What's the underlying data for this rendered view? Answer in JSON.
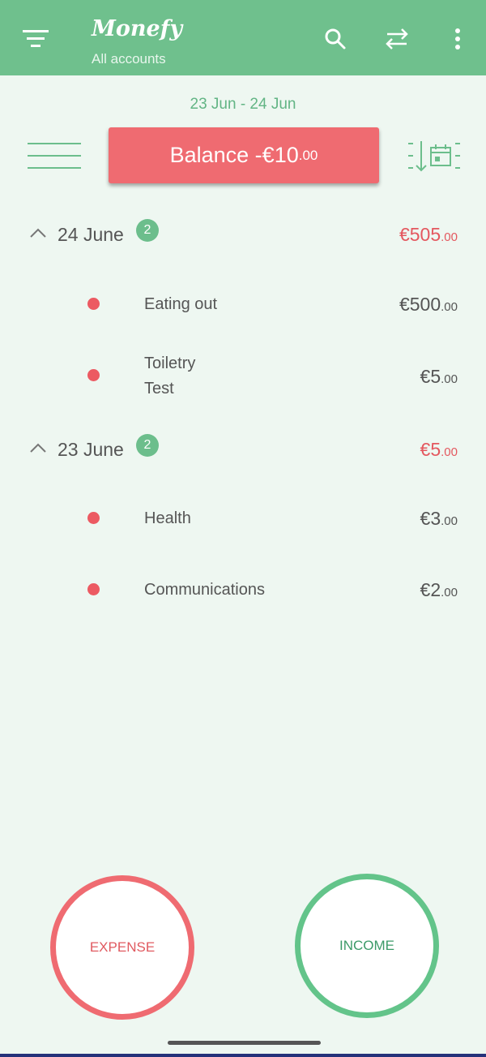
{
  "app": {
    "title": "Monefy",
    "subtitle": "All accounts"
  },
  "date_range": "23 Jun - 24 Jun",
  "balance": {
    "label": "Balance -€10",
    "cents": ".00"
  },
  "groups": [
    {
      "date": "24 June",
      "count": "2",
      "total": "€505",
      "total_cents": ".00",
      "items": [
        {
          "category": "Eating out",
          "note": "",
          "amount": "€500",
          "cents": ".00"
        },
        {
          "category": "Toiletry",
          "note": "Test",
          "amount": "€5",
          "cents": ".00"
        }
      ]
    },
    {
      "date": "23 June",
      "count": "2",
      "total": "€5",
      "total_cents": ".00",
      "items": [
        {
          "category": "Health",
          "note": "",
          "amount": "€3",
          "cents": ".00"
        },
        {
          "category": "Communications",
          "note": "",
          "amount": "€2",
          "cents": ".00"
        }
      ]
    }
  ],
  "actions": {
    "expense": "EXPENSE",
    "income": "INCOME"
  },
  "icons": {
    "filter": "filter-icon",
    "search": "search-icon",
    "transfer": "transfer-icon",
    "more": "more-vert-icon",
    "menu": "menu-icon",
    "sort_date": "sort-by-date-icon",
    "collapse": "chevron-up-icon"
  },
  "colors": {
    "primary": "#6fc08d",
    "expense": "#ef6b71",
    "income": "#63c48a",
    "background": "#eef7f1"
  }
}
